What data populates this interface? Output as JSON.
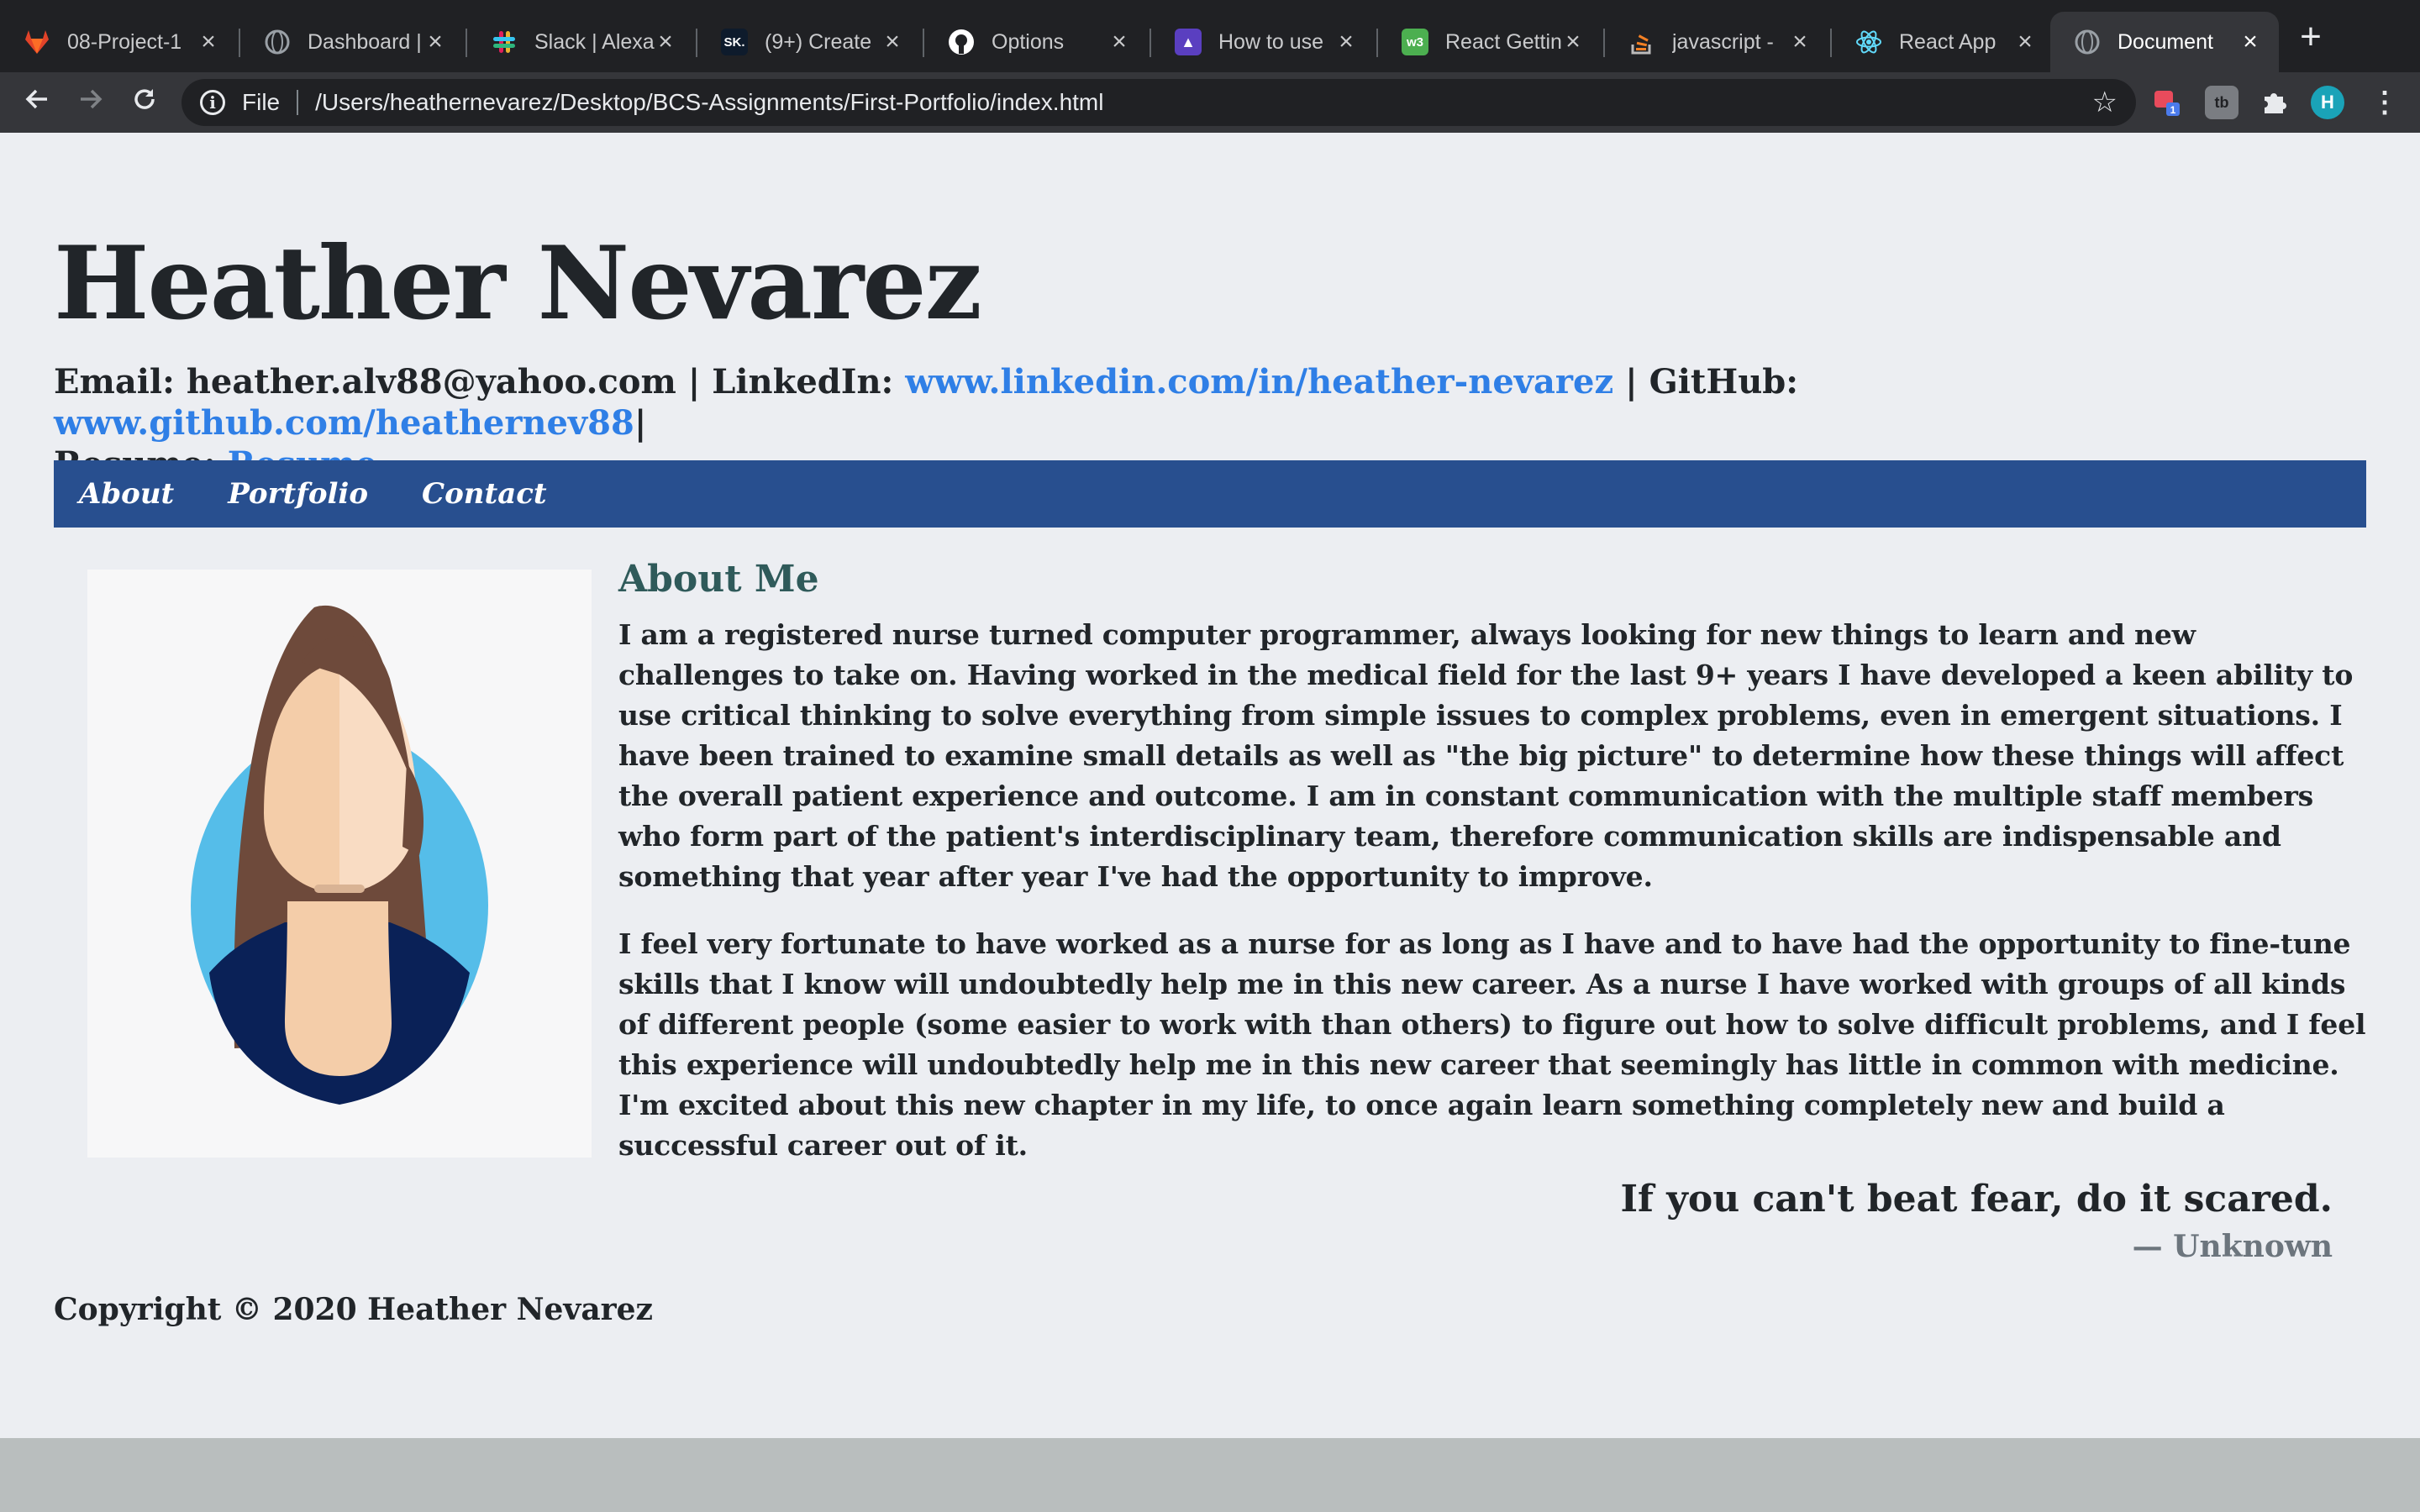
{
  "browser": {
    "tabs": [
      {
        "title": "08-Project-1",
        "icon": "gitlab-icon"
      },
      {
        "title": "Dashboard |",
        "icon": "globe-icon"
      },
      {
        "title": "Slack | Alexa",
        "icon": "slack-icon"
      },
      {
        "title": "(9+) Create",
        "icon": "sk-icon"
      },
      {
        "title": "Options",
        "icon": "github-icon"
      },
      {
        "title": "How to use",
        "icon": "rocket-icon"
      },
      {
        "title": "React Gettin",
        "icon": "w3schools-icon"
      },
      {
        "title": "javascript -",
        "icon": "stackoverflow-icon"
      },
      {
        "title": "React App",
        "icon": "react-icon"
      },
      {
        "title": "Document",
        "icon": "globe-icon",
        "active": true
      }
    ],
    "address": {
      "scheme_label": "File",
      "url": "/Users/heathernevarez/Desktop/BCS-Assignments/First-Portfolio/index.html"
    },
    "extension_badge": "1",
    "profile_initial": "H",
    "ext_tb_label": "tb"
  },
  "page": {
    "name": "Heather Nevarez",
    "contact": {
      "email_label": "Email: heather.alv88@yahoo.com | LinkedIn: ",
      "linkedin_link": "www.linkedin.com/in/heather-nevarez",
      "github_label": " | GitHub: ",
      "github_link": "www.github.com/heathernev88",
      "separator": "|",
      "resume_label": "Resume: ",
      "resume_link": "Resume"
    },
    "nav": [
      "About",
      "Portfolio",
      "Contact"
    ],
    "about": {
      "heading": "About Me",
      "paragraphs": [
        "I am a registered nurse turned computer programmer, always looking for new things to learn and new challenges to take on. Having worked in the medical field for the last 9+ years I have developed a keen ability to use critical thinking to solve everything from simple issues to complex problems, even in emergent situations. I have been trained to examine small details as well as \"the big picture\" to determine how these things will affect the overall patient experience and outcome. I am in constant communication with the multiple staff members who form part of the patient's interdisciplinary team, therefore communication skills are indispensable and something that year after year I've had the opportunity to improve.",
        "I feel very fortunate to have worked as a nurse for as long as I have and to have had the opportunity to fine-tune skills that I know will undoubtedly help me in this new career. As a nurse I have worked with groups of all kinds of different people (some easier to work with than others) to figure out how to solve difficult problems, and I feel this experience will undoubtedly help me in this new career that seemingly has little in common with medicine. I'm excited about this new chapter in my life, to once again learn something completely new and build a successful career out of it."
      ]
    },
    "quote": {
      "text": "If you can't beat fear, do it scared.",
      "author": "— Unknown"
    },
    "copyright": "Copyright © 2020 Heather Nevarez"
  },
  "colors": {
    "nav_bar": "#284f8f",
    "link": "#2f7fe6",
    "page_bg": "#eceef2",
    "heading": "#2f5a5a"
  }
}
